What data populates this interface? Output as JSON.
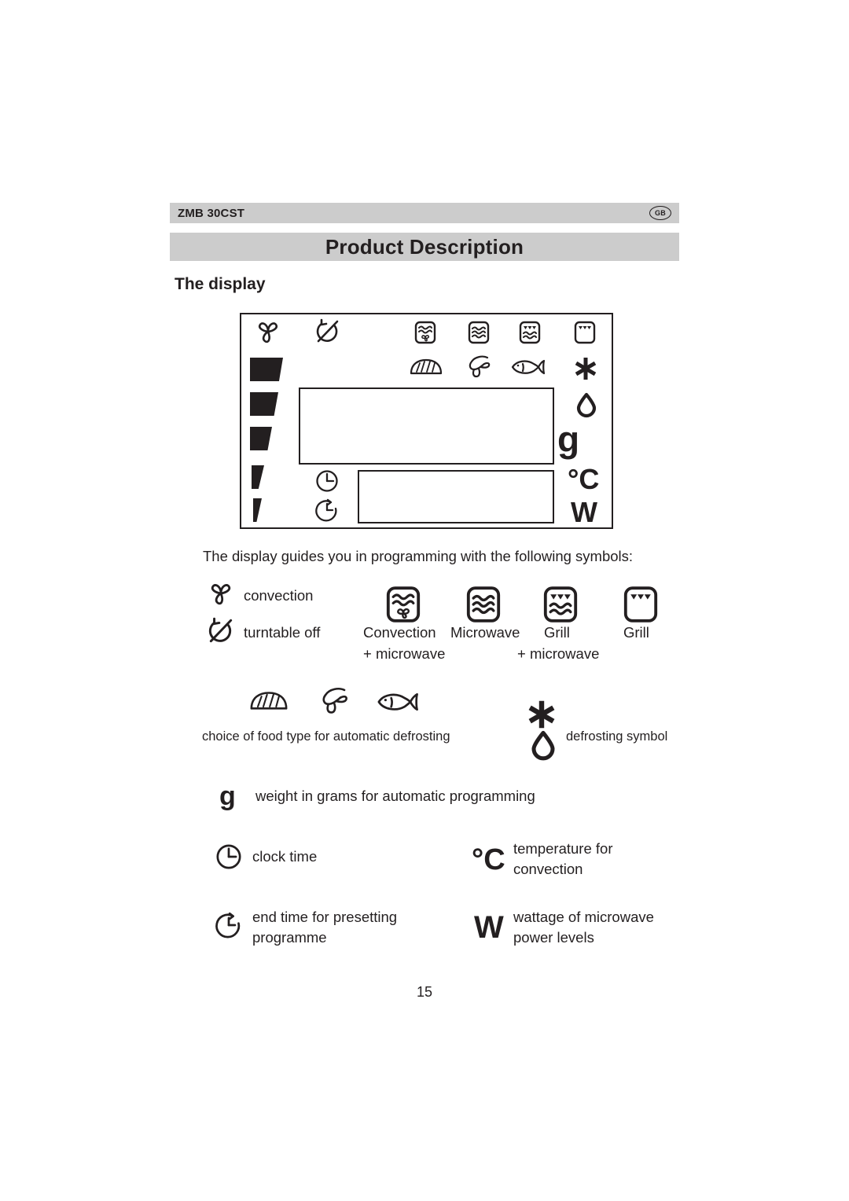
{
  "header": {
    "model": "ZMB 30CST",
    "region_badge": "GB",
    "title": "Product Description"
  },
  "section": {
    "heading": "The display",
    "intro": "The display guides you in programming with the following symbols:"
  },
  "display_panel": {
    "top_icons": [
      "convection-fan-icon",
      "turntable-off-icon",
      "convection-microwave-mode-icon",
      "microwave-mode-icon",
      "grill-microwave-mode-icon",
      "grill-mode-icon"
    ],
    "food_icons": [
      "bread-icon",
      "poultry-icon",
      "fish-icon"
    ],
    "right_symbols": [
      {
        "name": "defrost-asterisk-icon"
      },
      {
        "name": "defrost-droplet-icon"
      },
      {
        "name": "grams-unit",
        "text": "g"
      },
      {
        "name": "celsius-unit",
        "text": "°C"
      },
      {
        "name": "watt-unit",
        "text": "W"
      }
    ],
    "clock_icons": [
      "clock-time-icon",
      "end-time-icon"
    ],
    "power_bars": 5
  },
  "legend": {
    "convection": "convection",
    "turntable_off": "turntable off",
    "modes": [
      {
        "line1": "Convection",
        "line2": "+ microwave"
      },
      {
        "line1": "Microwave",
        "line2": ""
      },
      {
        "line1": "Grill",
        "line2": "+ microwave"
      },
      {
        "line1": "Grill",
        "line2": ""
      }
    ],
    "food_choice": "choice of food type for automatic defrosting",
    "defrosting_symbol": "defrosting symbol",
    "grams_glyph": "g",
    "grams_text": "weight in grams for automatic programming",
    "clock_time": "clock time",
    "celsius_glyph": "°C",
    "celsius_line1": "temperature for",
    "celsius_line2": "convection",
    "end_time_line1": "end time for presetting",
    "end_time_line2": "programme",
    "watt_glyph": "W",
    "watt_line1": "wattage of microwave",
    "watt_line2": "power levels"
  },
  "footer": {
    "page_number": "15"
  },
  "colors": {
    "ink": "#231f20",
    "band": "#cccccc",
    "paper": "#ffffff"
  }
}
